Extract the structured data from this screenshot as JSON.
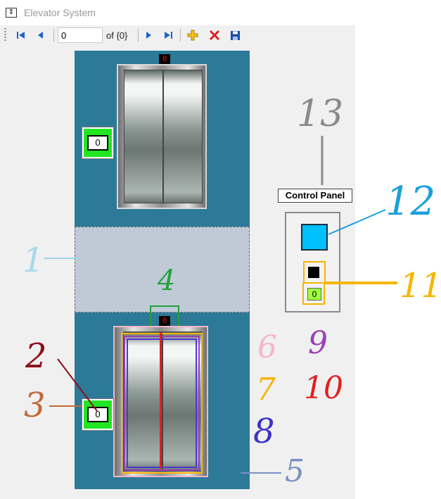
{
  "window": {
    "title": "Elevator System",
    "icon": "elevator-app-icon"
  },
  "toolbar": {
    "position_value": "0",
    "count_text": "of {0}",
    "icons": [
      "move-first-icon",
      "move-previous-icon",
      "move-next-icon",
      "move-last-icon",
      "add-new-icon",
      "delete-icon",
      "save-icon"
    ]
  },
  "elevators": [
    {
      "floor_indicator": "0",
      "call_button_label": "0"
    },
    {
      "floor_indicator": "0",
      "call_button_label": "0"
    }
  ],
  "control_panel": {
    "label": "Control Panel",
    "floor_value": "0"
  },
  "annotations": {
    "n1": "1",
    "n2": "2",
    "n3": "3",
    "n4": "4",
    "n5": "5",
    "n6": "6",
    "n7": "7",
    "n8": "8",
    "n9": "9",
    "n10": "10",
    "n11": "11",
    "n12": "12",
    "n13": "13"
  },
  "colors": {
    "shaft": "#2c7a98",
    "gap": "#bfcad6",
    "call_button": "#22e622",
    "control_square": "#00bfff",
    "floor_display_bg": "#9eff3a"
  }
}
